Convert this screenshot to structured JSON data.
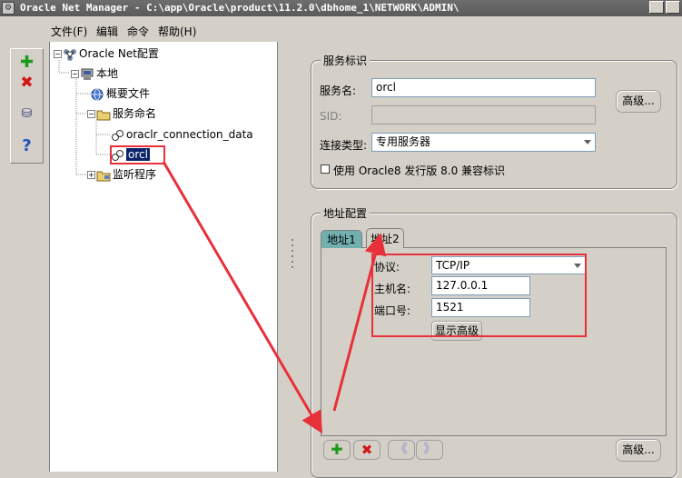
{
  "window": {
    "title": "Oracle Net Manager - C:\\app\\Oracle\\product\\11.2.0\\dbhome_1\\NETWORK\\ADMIN\\"
  },
  "menu": [
    "文件(F)",
    "编辑",
    "命令",
    "帮助(H)"
  ],
  "toolbar": {
    "icons": [
      "add-icon",
      "delete-icon",
      "test-icon",
      "help-icon"
    ]
  },
  "tree": {
    "root": "Oracle Net配置",
    "local": "本地",
    "profile": "概要文件",
    "service_naming": "服务命名",
    "service_items": [
      "oraclr_connection_data",
      "orcl"
    ],
    "listeners": "监听程序"
  },
  "service_id": {
    "title": "服务标识",
    "service_name_label": "服务名:",
    "service_name_value": "orcl",
    "sid_label": "SID:",
    "sid_value": "",
    "advanced_button": "高级...",
    "connection_type_label": "连接类型:",
    "connection_type_value": "专用服务器",
    "compat_checkbox_label": "使用 Oracle8 发行版 8.0 兼容标识",
    "compat_checked": false
  },
  "address_config": {
    "title": "地址配置",
    "tabs": [
      "地址1",
      "地址2"
    ],
    "active_tab": "地址2",
    "protocol_label": "协议:",
    "protocol_value": "TCP/IP",
    "host_label": "主机名:",
    "host_value": "127.0.0.1",
    "port_label": "端口号:",
    "port_value": "1521",
    "show_advanced_button": "显示高级",
    "bottom_advanced_button": "高级..."
  },
  "colors": {
    "annotation_red": "#e8303a",
    "selection": "#0a246a",
    "add_green": "#1e9a1e",
    "delete_red": "#d01818"
  }
}
